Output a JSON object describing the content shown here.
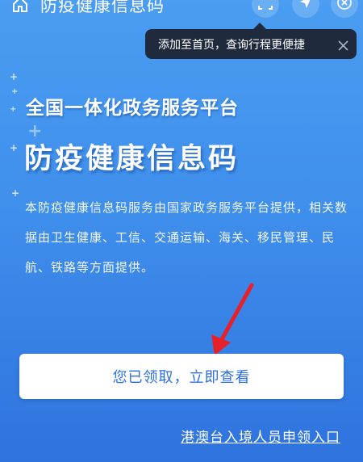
{
  "header": {
    "title": "防疫健康信息码",
    "icons": [
      "home-icon",
      "scan-icon",
      "location-icon",
      "close-icon"
    ]
  },
  "tip": {
    "text": "添加至首页，查询行程更便捷",
    "close_icon": "×"
  },
  "hero": {
    "platform_title": "全国一体化政务服务平台",
    "code_title": "防疫健康信息码",
    "description": "本防疫健康信息码服务由国家政务服务平台提供，相关数据由卫生健康、工信、交通运输、海关、移民管理、民航、铁路等方面提供。"
  },
  "actions": {
    "claim_button": "您已领取，立即查看",
    "entry_link": "港澳台入境人员申领入口"
  },
  "colors": {
    "background_top": "#4a9df1",
    "background_bottom": "#2f73de",
    "button_text": "#2d6fe0",
    "tip_bg": "#1f2b3d",
    "arrow": "#e8202a"
  }
}
